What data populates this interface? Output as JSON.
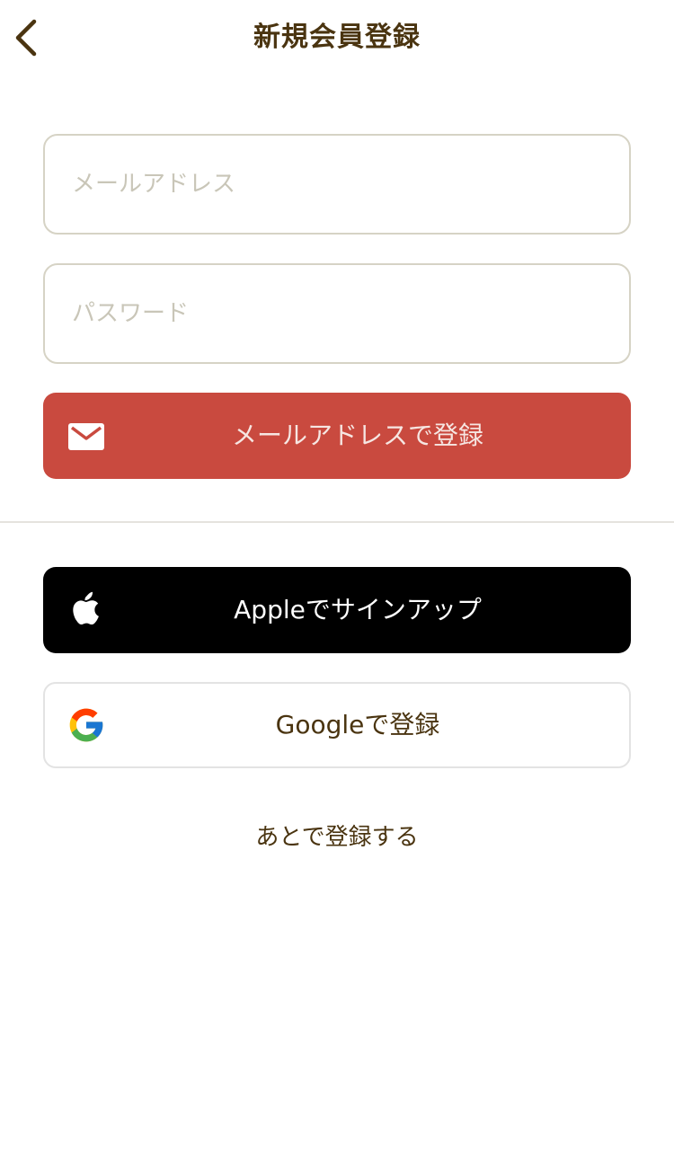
{
  "header": {
    "title": "新規会員登録",
    "back_icon": "chevron-left-icon"
  },
  "form": {
    "email_placeholder": "メールアドレス",
    "email_value": "",
    "password_placeholder": "パスワード",
    "password_value": ""
  },
  "buttons": {
    "email_signup": {
      "label": "メールアドレスで登録",
      "icon": "mail-icon",
      "bg_color": "#c94a3f"
    },
    "apple_signup": {
      "label": "Appleでサインアップ",
      "icon": "apple-logo-icon",
      "bg_color": "#000000"
    },
    "google_signup": {
      "label": "Googleで登録",
      "icon": "google-logo-icon",
      "bg_color": "#ffffff"
    }
  },
  "later_link": {
    "label": "あとで登録する"
  },
  "colors": {
    "text_primary": "#4a3410",
    "placeholder": "#c9c6b8",
    "field_border": "#d6d3c5",
    "divider": "#e5e3de"
  }
}
